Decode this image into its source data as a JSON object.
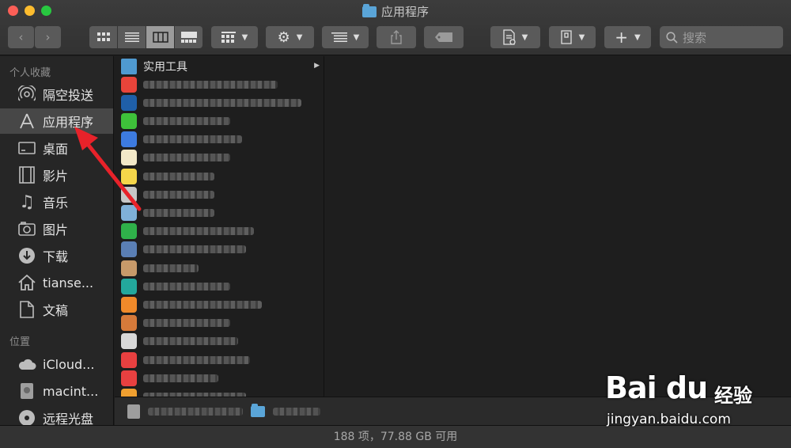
{
  "window": {
    "title": "应用程序"
  },
  "toolbar": {
    "back_icon": "chevron-left-icon",
    "forward_icon": "chevron-right-icon",
    "view_modes": [
      "icon-view",
      "list-view",
      "column-view",
      "gallery-view"
    ],
    "active_view": "column-view",
    "search_placeholder": "搜索"
  },
  "sidebar": {
    "favorites_title": "个人收藏",
    "favorites": [
      {
        "label": "隔空投送",
        "icon": "airdrop-icon"
      },
      {
        "label": "应用程序",
        "icon": "applications-icon",
        "selected": true
      },
      {
        "label": "桌面",
        "icon": "desktop-icon"
      },
      {
        "label": "影片",
        "icon": "movies-icon"
      },
      {
        "label": "音乐",
        "icon": "music-icon"
      },
      {
        "label": "图片",
        "icon": "pictures-icon"
      },
      {
        "label": "下载",
        "icon": "downloads-icon"
      },
      {
        "label": "tianse...",
        "icon": "home-icon"
      },
      {
        "label": "文稿",
        "icon": "documents-icon"
      }
    ],
    "locations_title": "位置",
    "locations": [
      {
        "label": "iCloud...",
        "icon": "icloud-icon"
      },
      {
        "label": "macint...",
        "icon": "hard-drive-icon"
      },
      {
        "label": "远程光盘",
        "icon": "disc-icon"
      }
    ]
  },
  "file_list": {
    "first_item": "实用工具",
    "icon_colors": [
      "#e8443a",
      "#1f5fa8",
      "#3ec13a",
      "#3d7be0",
      "#f2e8c8",
      "#f5d64a",
      "#c7c7c7",
      "#7fb0d8",
      "#2fb14a",
      "#5a7fb5",
      "#c79a6a",
      "#23a89c",
      "#f08a2a",
      "#d67a3a",
      "#d8d8d8",
      "#e84040",
      "#e84040",
      "#f0a030"
    ]
  },
  "status": {
    "text": "188 项，77.88 GB 可用"
  },
  "colors": {
    "annotation_arrow": "#e8222a"
  },
  "watermark": {
    "logo": "Bai  du",
    "cn": "经验",
    "url": "jingyan.baidu.com"
  }
}
